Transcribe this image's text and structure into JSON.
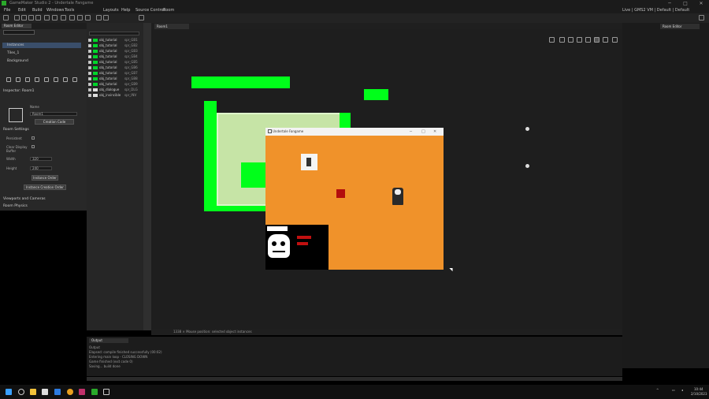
{
  "window": {
    "app_title": "GameMaker Studio 2 - Undertale Fangame",
    "minimize": "─",
    "maximize": "□",
    "close": "✕"
  },
  "menu": [
    "File",
    "Edit",
    "Build",
    "Windows",
    "Tools",
    "Layouts",
    "Help",
    "Source Control",
    "Room"
  ],
  "top_right": {
    "status": "Live | GMS2 VM | Default | Default",
    "workspace_tab": "Room Editor"
  },
  "left_panel": {
    "tab": "Room Editor",
    "search_placeholder": "",
    "layers": [
      {
        "label": "Instances",
        "selected": true
      },
      {
        "label": "Tiles_1",
        "selected": false
      },
      {
        "label": "Background",
        "selected": false
      }
    ],
    "inspector_title": "Inspector: Room1",
    "room_name_label": "Name",
    "room_name_value": "Room1",
    "create_code_btn": "Creation Code",
    "section_room_settings": "Room Settings",
    "persistent_label": "Persistent",
    "clear_display_label": "Clear Display Buffer",
    "width_label": "Width",
    "width_value": "320",
    "height_label": "Height",
    "height_value": "240",
    "instance_order_btn": "Instance Order",
    "instance_creation_btn": "Instance Creation Order",
    "section_viewports": "Viewports and Cameras",
    "section_physics": "Room Physics"
  },
  "asset_panel": {
    "rows": [
      {
        "name": "obj_tutorial",
        "sprite": "spr_GB1",
        "color": "#00d52a"
      },
      {
        "name": "obj_tutorial",
        "sprite": "spr_GB2",
        "color": "#00d52a"
      },
      {
        "name": "obj_tutorial",
        "sprite": "spr_GB3",
        "color": "#00d52a"
      },
      {
        "name": "obj_tutorial",
        "sprite": "spr_GB4",
        "color": "#00d52a"
      },
      {
        "name": "obj_tutorial",
        "sprite": "spr_GB5",
        "color": "#00d52a"
      },
      {
        "name": "obj_tutorial",
        "sprite": "spr_GB6",
        "color": "#00d52a"
      },
      {
        "name": "obj_tutorial",
        "sprite": "spr_GB7",
        "color": "#00d52a"
      },
      {
        "name": "obj_tutorial",
        "sprite": "spr_GB8",
        "color": "#00d52a"
      },
      {
        "name": "obj_tutorial",
        "sprite": "spr_GB9",
        "color": "#00d52a"
      },
      {
        "name": "obj_dialogue",
        "sprite": "spr_DLG",
        "color": "#dddddd"
      },
      {
        "name": "obj_invincible",
        "sprite": "spr_INV",
        "color": "#dddddd"
      }
    ]
  },
  "room_tab": "Room1",
  "status_line": "1338 × Mouse position: selected object instances",
  "output": {
    "tab": "Output",
    "lines": [
      "Output",
      "Elapsed: compile finished successfully (00:02)",
      "Entering main loop - CLOSING DOWN",
      "Game finished (exit code 0)",
      "Saving... build done"
    ]
  },
  "game_window": {
    "title": "Undertale Fangame"
  },
  "taskbar": {
    "clock_time": "10:44",
    "clock_date": "2/10/2023"
  }
}
